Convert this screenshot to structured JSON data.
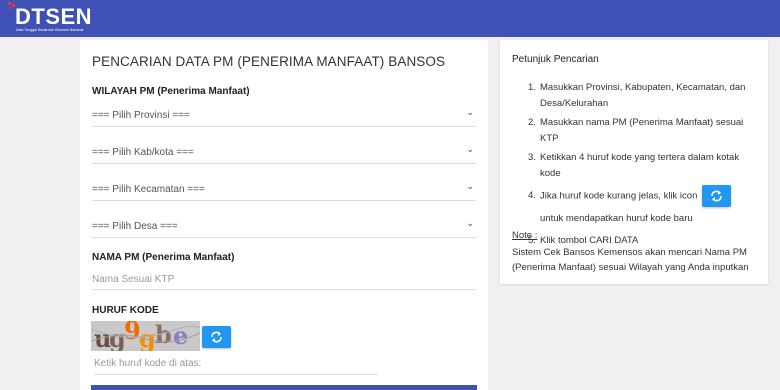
{
  "header": {
    "logo_text": "DTSEN",
    "logo_subtitle": "Data Tunggal Sosial dan Ekonomi Nasional"
  },
  "form": {
    "title": "PENCARIAN DATA PM (PENERIMA MANFAAT) BANSOS",
    "wilayah_label": "WILAYAH PM (Penerima Manfaat)",
    "provinsi": "=== Pilih Provinsi ===",
    "kabkota": "=== Pilih Kab/kota ===",
    "kecamatan": "=== Pilih Kecamatan ===",
    "desa": "=== Pilih Desa ===",
    "nama_label": "NAMA PM (Penerima Manfaat)",
    "nama_placeholder": "Nama Sesuai KTP",
    "kode_label": "HURUF KODE",
    "captcha_text": "ug9gbe",
    "kode_placeholder": "Ketik huruf kode di atas:"
  },
  "petunjuk": {
    "title": "Petunjuk Pencarian",
    "step1": "Masukkan Provinsi, Kabupaten, Kecamatan, dan Desa/Kelurahan",
    "step2": "Masukkan nama PM (Penerima Manfaat) sesuai KTP",
    "step3": "Ketikkan 4 huruf kode yang tertera dalam kotak kode",
    "step4a": "Jika huruf kode kurang jelas, klik icon",
    "step4b": "untuk mendapatkan huruf kode baru",
    "step5": "Klik tombol CARI DATA",
    "note_title": "Note :",
    "note_text": "Sistem Cek Bansos Kemensos akan mencari Nama PM (Penerima Manfaat) sesuai Wilayah yang Anda inputkan"
  },
  "colors": {
    "header": "#3f51b5",
    "refresh_button": "#2196f3"
  }
}
